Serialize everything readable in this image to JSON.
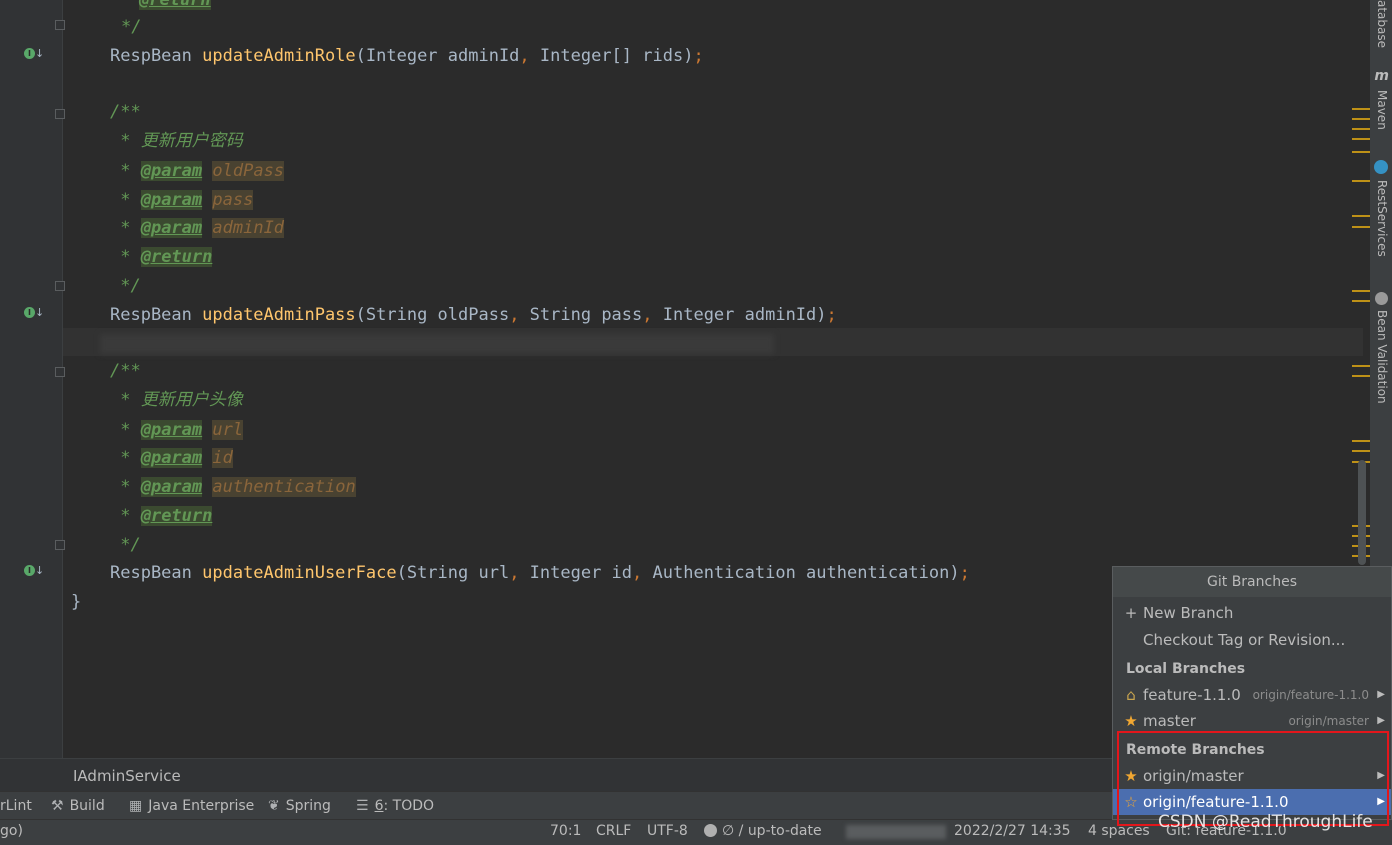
{
  "editor": {
    "lines": {
      "l0_return": "@return",
      "l0_close": "*/",
      "l1_type": "RespBean ",
      "l1_fn": "updateAdminRole",
      "l1_args_a": "(Integer adminId",
      "l1_comma1": ", ",
      "l1_args_b": "Integer[] rids)",
      "l1_semi": ";",
      "c1_open": "/**",
      "c1_desc": " * 更新用户密码",
      "c1_star": " * ",
      "c1_param": "@param",
      "c1_p1": "oldPass",
      "c1_p2": "pass",
      "c1_p3": "adminId",
      "c1_return": "@return",
      "c1_close": " */",
      "l2_type": "RespBean ",
      "l2_fn": "updateAdminPass",
      "l2_args_a": "(String oldPass",
      "l2_args_b": "String pass",
      "l2_args_c": "Integer adminId)",
      "l2_semi": ";",
      "c2_open": "/**",
      "c2_desc": " * 更新用户头像",
      "c2_p1": "url",
      "c2_p2": "id",
      "c2_p3": "authentication",
      "c2_return": "@return",
      "c2_close": " */",
      "l3_type": "RespBean ",
      "l3_fn": "updateAdminUserFace",
      "l3_args_a": "(String url",
      "l3_args_b": "Integer id",
      "l3_args_c": "Authentication authentication)",
      "l3_semi": ";",
      "closing_brace": "}"
    }
  },
  "right_tools": {
    "database": "atabase",
    "maven": "Maven",
    "rest": "RestServices",
    "bean": "Bean Validation",
    "maven_icon": "m"
  },
  "file_tab": {
    "name": "IAdminService"
  },
  "tool_windows": {
    "sonarlint": "rLint",
    "build": "Build",
    "java_enterprise": "Java Enterprise",
    "spring": "Spring",
    "todo_num": "6",
    "todo": ": TODO"
  },
  "status_bar": {
    "left": "go)",
    "position": "70:1",
    "line_sep": "CRLF",
    "encoding": "UTF-8",
    "vcs_status": "∅ / up-to-date",
    "datetime": "2022/2/27 14:35",
    "indent": "4 spaces",
    "git": "Git: feature-1.1.0"
  },
  "git_popup": {
    "title": "Git Branches",
    "new_branch": "New Branch",
    "checkout": "Checkout Tag or Revision...",
    "local_header": "Local Branches",
    "local": [
      {
        "name": "feature-1.1.0",
        "tracking": "origin/feature-1.1.0",
        "icon": "tag-icon"
      },
      {
        "name": "master",
        "tracking": "origin/master",
        "icon": "star-icon"
      }
    ],
    "remote_header": "Remote Branches",
    "remote": [
      {
        "name": "origin/master",
        "icon": "star-icon"
      },
      {
        "name": "origin/feature-1.1.0",
        "icon": "star-outline-icon"
      }
    ]
  },
  "watermark": "CSDN @ReadThroughLife",
  "colors": {
    "editor_bg": "#2b2b2b",
    "keyword": "#cc7832",
    "function": "#ffc66d",
    "comment": "#629755",
    "selection": "#4b6eaf",
    "highlight_box": "#e3161b"
  }
}
